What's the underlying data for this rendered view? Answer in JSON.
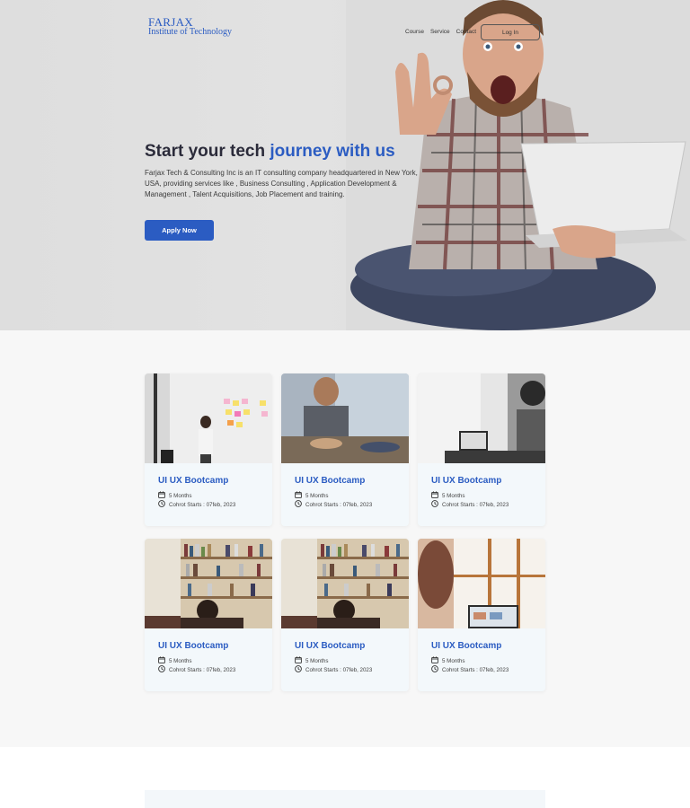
{
  "header": {
    "logo_line1": "FARJAX",
    "logo_line2": "Institute of Technology",
    "nav": [
      "Course",
      "Service",
      "Contact"
    ],
    "login_label": "Log In"
  },
  "hero": {
    "title_plain": "Start your tech ",
    "title_accent": "journey with us",
    "description": "Farjax Tech & Consulting Inc is an IT consulting company headquartered in New York, USA, providing services like , Business Consulting , Application Development & Management , Talent Acquisitions, Job Placement and training.",
    "apply_label": "Apply Now"
  },
  "courses": [
    {
      "title": "UI UX Bootcamp",
      "duration": "5 Months",
      "start": "Cohrot Starts : 07feb, 2023",
      "image": "office-whiteboard"
    },
    {
      "title": "UI UX Bootcamp",
      "duration": "5 Months",
      "start": "Cohrot Starts : 07feb, 2023",
      "image": "meeting-table"
    },
    {
      "title": "UI UX Bootcamp",
      "duration": "5 Months",
      "start": "Cohrot Starts : 07feb, 2023",
      "image": "laptop-desk"
    },
    {
      "title": "UI UX Bootcamp",
      "duration": "5 Months",
      "start": "Cohrot Starts : 07feb, 2023",
      "image": "library-student"
    },
    {
      "title": "UI UX Bootcamp",
      "duration": "5 Months",
      "start": "Cohrot Starts : 07feb, 2023",
      "image": "library-student"
    },
    {
      "title": "UI UX Bootcamp",
      "duration": "5 Months",
      "start": "Cohrot Starts : 07feb, 2023",
      "image": "window-laptop"
    }
  ],
  "colors": {
    "accent": "#2b5cc2",
    "dark_text": "#2b2b3a",
    "card_bg": "#f3f8fb",
    "section_bg": "#f7f7f7"
  }
}
